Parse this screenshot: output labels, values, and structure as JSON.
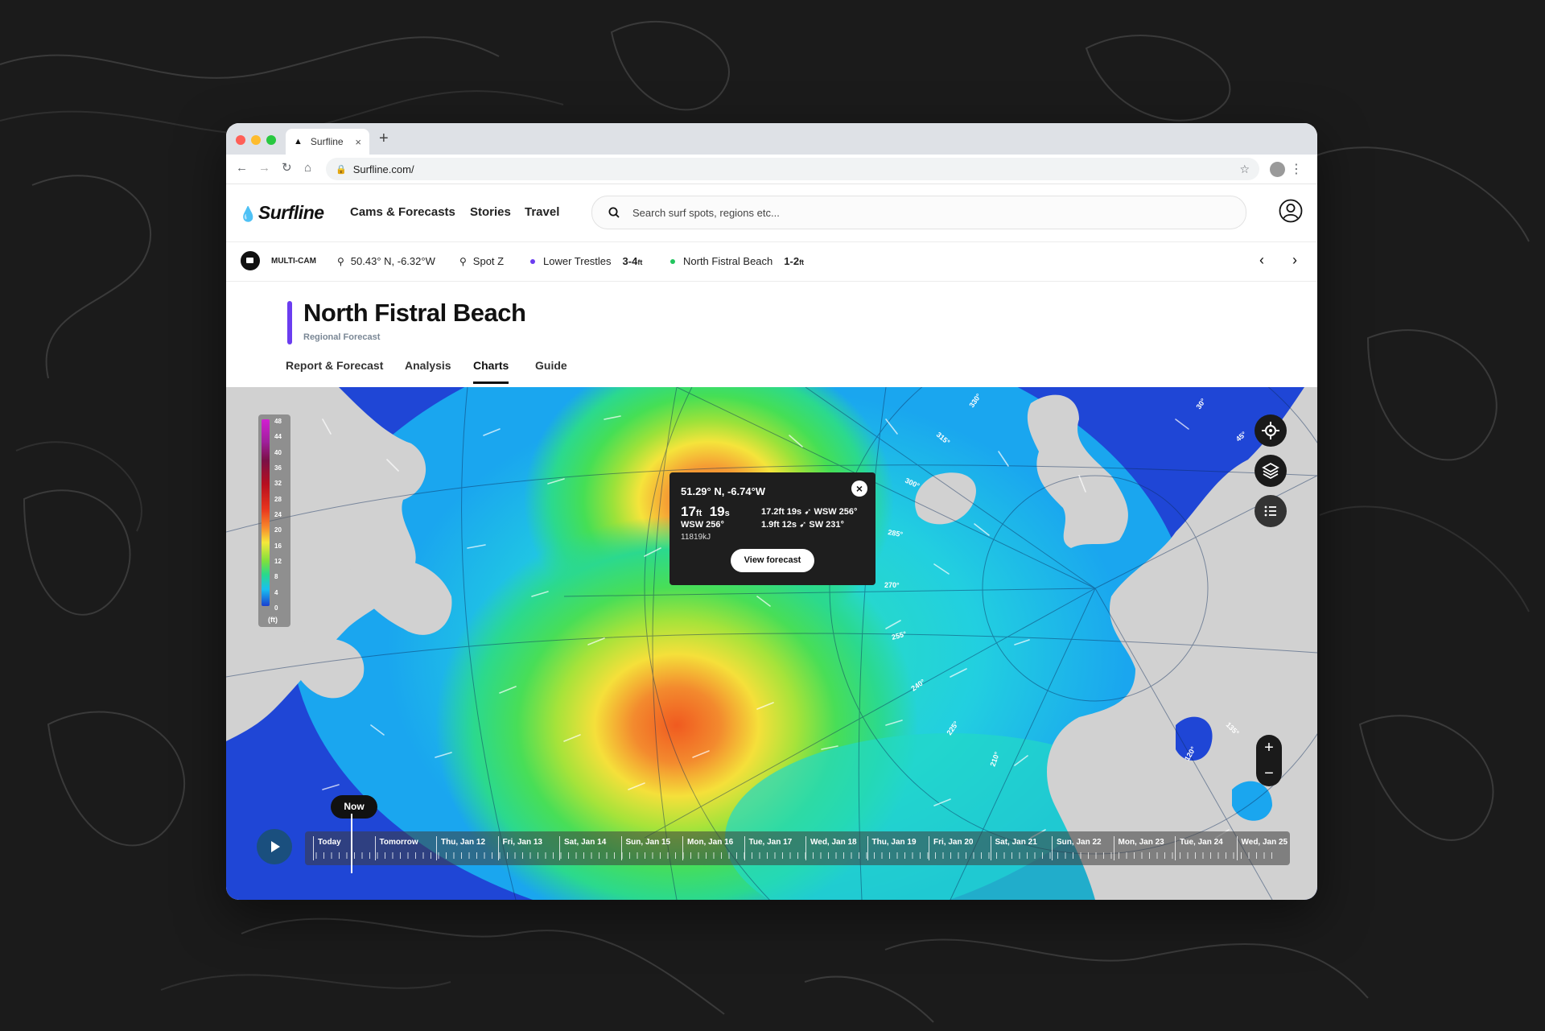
{
  "browser": {
    "tab_title": "Surfline",
    "url": "Surfline.com/"
  },
  "header": {
    "logo": "Surfline",
    "nav": [
      "Cams & Forecasts",
      "Stories",
      "Travel"
    ],
    "search_placeholder": "Search surf spots, regions etc..."
  },
  "spotbar": {
    "multicam": "MULTI-CAM",
    "coords": "50.43° N, -6.32°W",
    "spot_z": "Spot Z",
    "spot1": {
      "name": "Lower Trestles",
      "height": "3-4",
      "unit": "ft",
      "color": "#6b3df0"
    },
    "spot2": {
      "name": "North Fistral Beach",
      "height": "1-2",
      "unit": "ft",
      "color": "#22c55e"
    }
  },
  "page": {
    "title": "North Fistral Beach",
    "subtitle": "Regional Forecast",
    "tabs": [
      "Report & Forecast",
      "Analysis",
      "Charts",
      "Guide"
    ],
    "active_tab": "Charts"
  },
  "legend": {
    "ticks": [
      "48",
      "44",
      "40",
      "36",
      "32",
      "28",
      "24",
      "20",
      "16",
      "12",
      "8",
      "4",
      "0"
    ],
    "unit": "(ft)"
  },
  "popup": {
    "coords": "51.29° N, -6.74°W",
    "height": "17",
    "height_unit": "ft",
    "period": "19",
    "period_unit": "s",
    "direction": "WSW 256°",
    "energy": "11819kJ",
    "swells": [
      "17.2ft  19s  ➹ WSW 256°",
      "1.9ft   12s  ➹ SW 231°"
    ],
    "button": "View forecast"
  },
  "timeline": {
    "now_label": "Now",
    "days": [
      "Today",
      "Tomorrow",
      "Thu, Jan 12",
      "Fri, Jan 13",
      "Sat, Jan 14",
      "Sun, Jan 15",
      "Mon, Jan 16",
      "Tue, Jan 17",
      "Wed, Jan 18",
      "Thu, Jan 19",
      "Fri, Jan 20",
      "Sat, Jan 21",
      "Sun, Jan 22",
      "Mon, Jan 23",
      "Tue, Jan 24",
      "Wed, Jan 25"
    ]
  },
  "bearings": [
    "330°",
    "315°",
    "300°",
    "285°",
    "270°",
    "255°",
    "240°",
    "225°",
    "210°",
    "30°",
    "45°",
    "135°",
    "120°"
  ],
  "colors": {
    "accent": "#6b3df0",
    "ocean_low": "#1a3fcf",
    "ocean_mid": "#19c0f0",
    "swell_green": "#2ad98a",
    "swell_peak": "#f88a2c",
    "land": "#d0d0d0"
  }
}
